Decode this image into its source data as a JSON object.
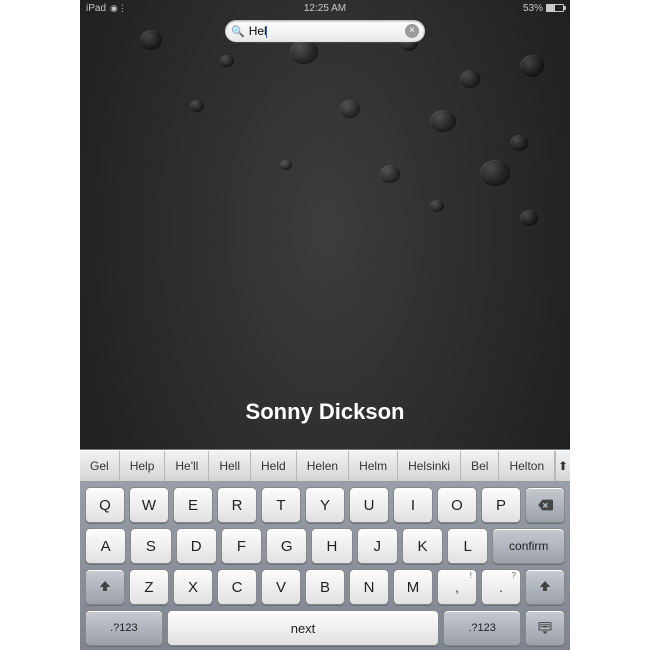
{
  "status": {
    "carrier": "iPad",
    "wifi_icon": "wifi-icon",
    "time": "12:25 AM",
    "battery_percent": "53%",
    "battery_level": 53
  },
  "search": {
    "value": "Hel",
    "clear_icon": "×"
  },
  "watermark": "Sonny Dickson",
  "suggestions": [
    "Gel",
    "Help",
    "He'll",
    "Hell",
    "Held",
    "Helen",
    "Helm",
    "Helsinki",
    "Bel",
    "Helton"
  ],
  "keys": {
    "row1": [
      "Q",
      "W",
      "E",
      "R",
      "T",
      "Y",
      "U",
      "I",
      "O",
      "P"
    ],
    "row2": [
      "A",
      "S",
      "D",
      "F",
      "G",
      "H",
      "J",
      "K",
      "L"
    ],
    "row3": [
      "Z",
      "X",
      "C",
      "V",
      "B",
      "N",
      "M"
    ],
    "punct": {
      "comma": ",",
      "comma_alt": "!",
      "period": ".",
      "period_alt": "?"
    },
    "confirm": "confirm",
    "numswitch": ".?123",
    "space": "next",
    "backspace": "backspace-icon",
    "shift": "shift-icon",
    "hide": "hide-keyboard-icon"
  }
}
